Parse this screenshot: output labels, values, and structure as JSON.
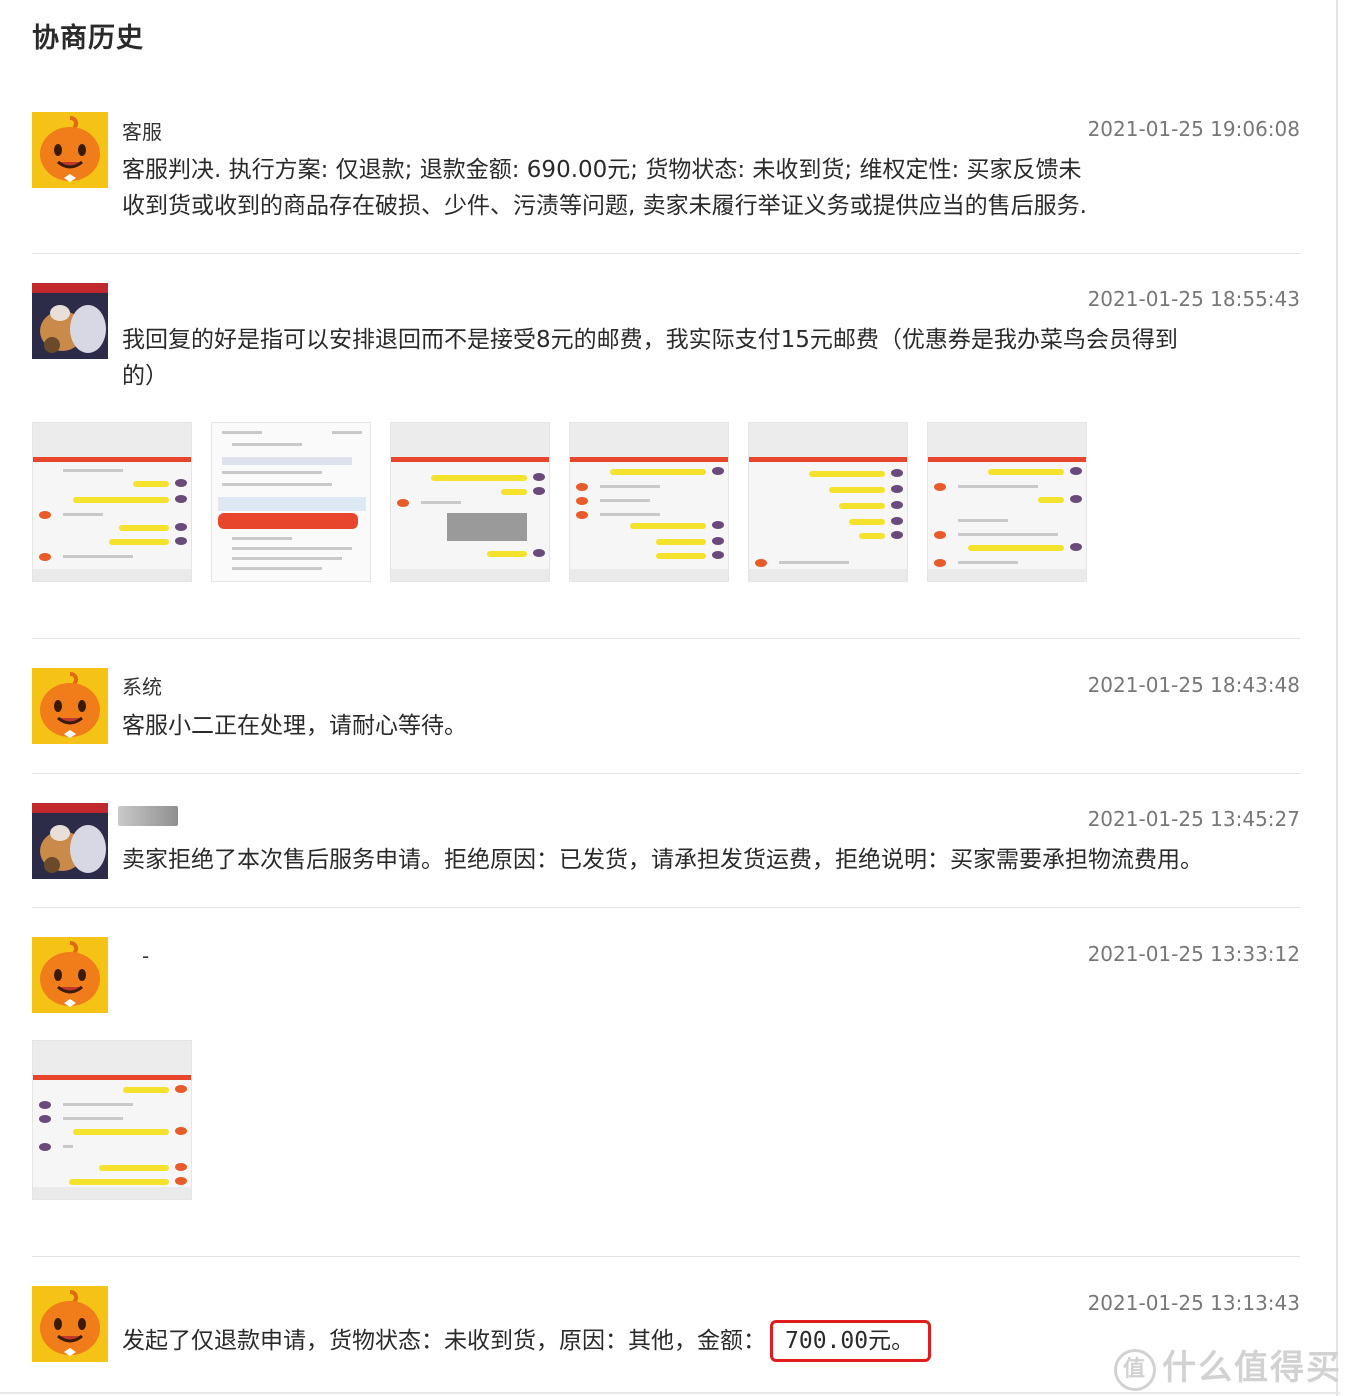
{
  "header": {
    "title": "协商历史"
  },
  "entries": [
    {
      "name": "客服",
      "time": "2021-01-25 19:06:08",
      "message_line1": "客服判决. 执行方案: 仅退款; 退款金额: 690.00元; 货物状态: 未收到货; 维权定性: 买家反馈未",
      "message_line2": "收到货或收到的商品存在破损、少件、污渍等问题, 卖家未履行举证义务或提供应当的售后服务."
    },
    {
      "name": "",
      "time": "2021-01-25 18:55:43",
      "message_line1": "我回复的好是指可以安排退回而不是接受8元的邮费，我实际支付15元邮费（优惠券是我办菜鸟会员得到",
      "message_line2": "的）"
    },
    {
      "name": "系统",
      "time": "2021-01-25 18:43:48",
      "message_line1": "客服小二正在处理，请耐心等待。"
    },
    {
      "name": "",
      "time": "2021-01-25 13:45:27",
      "message_line1": "卖家拒绝了本次售后服务申请。拒绝原因：已发货，请承担发货运费，拒绝说明：买家需要承担物流费用。"
    },
    {
      "name": "-",
      "time": "2021-01-25 13:33:12"
    },
    {
      "name": "",
      "time": "2021-01-25 13:13:43",
      "message_prefix": "发起了仅退款申请，货物状态：未收到货，原因：其他，金额：",
      "amount": "700.00元。"
    }
  ],
  "watermark": {
    "circle": "值",
    "text": "什么值得买"
  },
  "icons": {
    "mascot": "orange-mascot-avatar",
    "user": "user-photo-avatar"
  },
  "colors": {
    "highlight": "#e01c1c",
    "mascot_bg": "#f5c316",
    "mascot_orange": "#f07c1a"
  }
}
